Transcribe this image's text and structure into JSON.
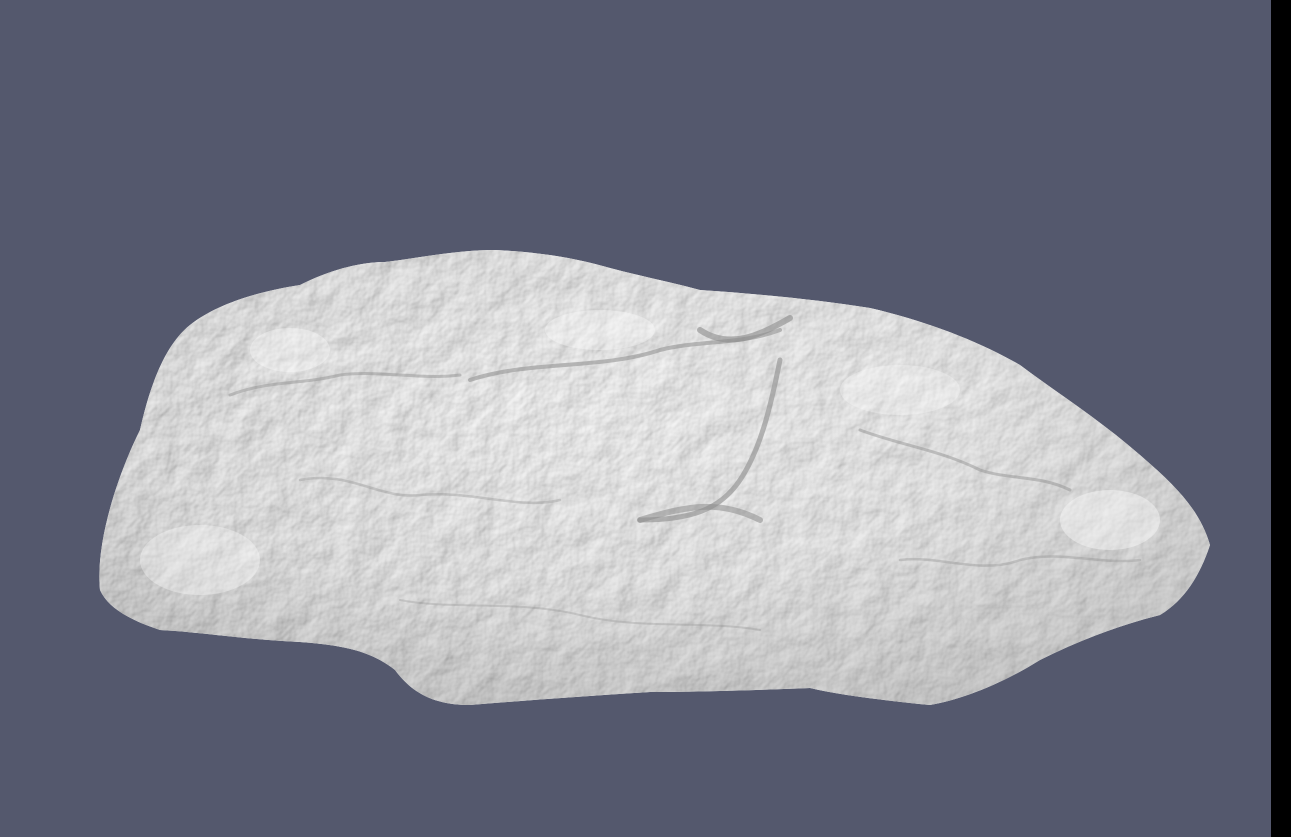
{
  "app": {
    "view_type": "3D mesh viewport"
  },
  "viewport": {
    "background_color": "#54586D",
    "side_edge_color": "#000000",
    "object": {
      "kind": "scanned rock mesh",
      "surface_color": "#F2F2F2",
      "shadow_color": "#8C8C8C",
      "highlight_color": "#FFFFFF"
    }
  },
  "icons": {
    "rock": "rock-model-icon"
  }
}
